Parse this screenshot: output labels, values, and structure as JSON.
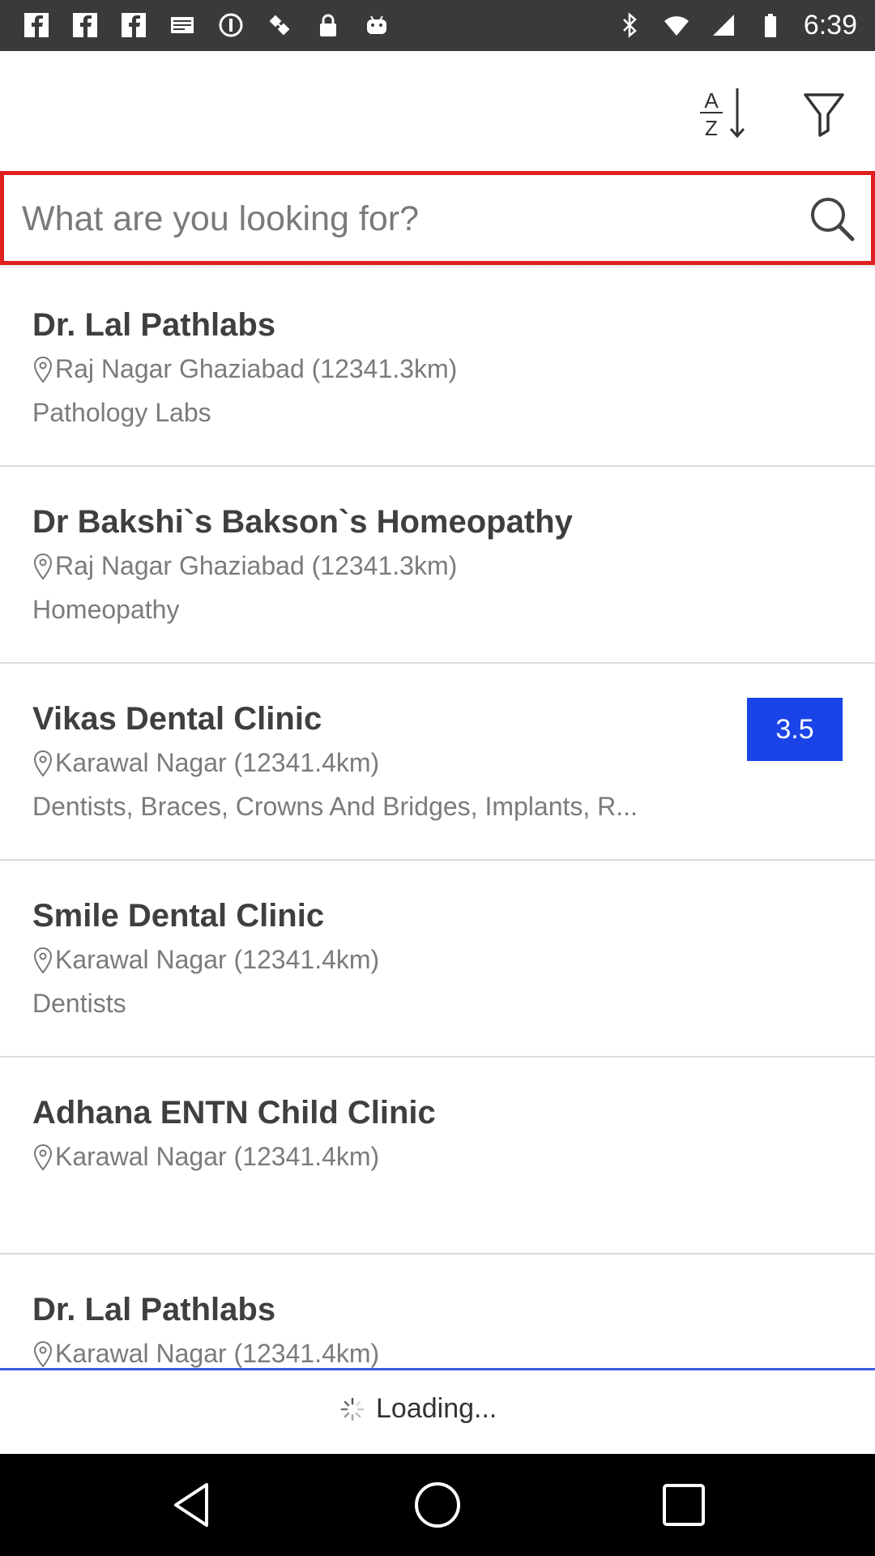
{
  "status_bar": {
    "time": "6:39",
    "left_icons": [
      "fb-icon",
      "fb-icon",
      "fb-icon",
      "mail-icon",
      "blocked-icon",
      "satellite-icon",
      "lock-icon",
      "android-icon"
    ],
    "right_icons": [
      "bluetooth-icon",
      "wifi-icon",
      "signal-icon",
      "battery-icon"
    ]
  },
  "toolbar": {
    "sort_icon": "sort-az-icon",
    "filter_icon": "filter-icon"
  },
  "search": {
    "placeholder": "What are you looking for?",
    "value": "",
    "border_color": "#e01f1f"
  },
  "listings": [
    {
      "name": "Dr. Lal Pathlabs",
      "location": "Raj Nagar Ghaziabad (12341.3km)",
      "category": "Pathology Labs",
      "rating": null
    },
    {
      "name": "Dr Bakshi`s Bakson`s Homeopathy",
      "location": "Raj Nagar Ghaziabad (12341.3km)",
      "category": "Homeopathy",
      "rating": null
    },
    {
      "name": "Vikas Dental Clinic",
      "location": "Karawal Nagar (12341.4km)",
      "category": "Dentists, Braces, Crowns And Bridges, Implants, R...",
      "rating": "3.5"
    },
    {
      "name": "Smile Dental Clinic",
      "location": "Karawal Nagar (12341.4km)",
      "category": "Dentists",
      "rating": null
    },
    {
      "name": "Adhana ENTN Child Clinic",
      "location": "Karawal Nagar (12341.4km)",
      "category": "",
      "rating": null
    },
    {
      "name": "Dr. Lal Pathlabs",
      "location": "Karawal Nagar (12341.4km)",
      "category": "",
      "rating": null
    }
  ],
  "loading": {
    "text": "Loading..."
  },
  "colors": {
    "rating_bg": "#1a44e8",
    "accent_line": "#3b5fe0"
  }
}
